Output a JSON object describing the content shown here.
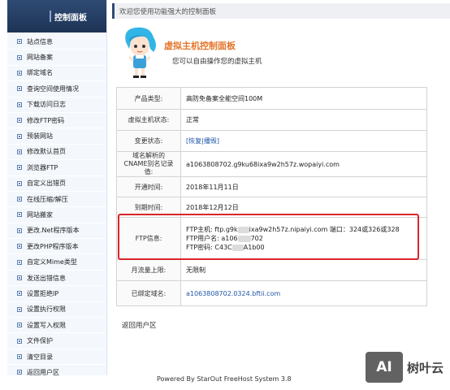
{
  "sidebar": {
    "title": "控制面板",
    "items": [
      {
        "label": "站点信息"
      },
      {
        "label": "网站备案"
      },
      {
        "label": "绑定域名"
      },
      {
        "label": "查询空间使用情况"
      },
      {
        "label": "下载访问日志"
      },
      {
        "label": "修改FTP密码"
      },
      {
        "label": "预装网站"
      },
      {
        "label": "修改默认首页"
      },
      {
        "label": "浏览器FTP"
      },
      {
        "label": "自定义出错页"
      },
      {
        "label": "在线压缩/解压"
      },
      {
        "label": "网站搬家"
      },
      {
        "label": "更改.Net程序版本"
      },
      {
        "label": "更改PHP程序版本"
      },
      {
        "label": "自定义Mime类型"
      },
      {
        "label": "发送出错信息"
      },
      {
        "label": "设置拒绝IP"
      },
      {
        "label": "设置执行权限"
      },
      {
        "label": "设置写入权限"
      },
      {
        "label": "文件保护"
      },
      {
        "label": "清空目录"
      },
      {
        "label": "返回用户区"
      }
    ]
  },
  "topbar": {
    "welcome": "欢迎您使用功能强大的控制面板"
  },
  "hero": {
    "title": "虚拟主机控制面板",
    "subtitle": "您可以自由操作您的虚拟主机"
  },
  "info": {
    "product_type_label": "产品类型:",
    "product_type_value": "高防免备案全能空间100M",
    "status_label": "虚拟主机状态:",
    "status_value": "正常",
    "change_label": "变更状态:",
    "change_value": "[恢复|播毁]",
    "cname_label": "域名解析的CNAME别名记录值:",
    "cname_value": "a1063808702.g9ku68ixa9w2h57z.wopaiyi.com",
    "open_label": "开通时间:",
    "open_value": "2018年11月11日",
    "expire_label": "到期时间:",
    "expire_value": "2018年12月12日",
    "ftp_label": "FTP信息:",
    "ftp_host_prefix": "FTP主机: ftp.g9k",
    "ftp_host_suffix": "ixa9w2h57z.nipaiyi.com 端口：324或326或328",
    "ftp_user_prefix": "FTP用户名: a106",
    "ftp_user_suffix": "702",
    "ftp_pass_prefix": "FTP密码: C43C",
    "ftp_pass_suffix": "A1b00",
    "traffic_label": "月流量上限:",
    "traffic_value": "无限制",
    "bound_label": "已绑定域名:",
    "bound_value": "a1063808702.0324.bftii.com"
  },
  "back_link": "返回用户区",
  "footer": "Powered By StarOut FreeHost System 3.8",
  "watermark": {
    "logo": "AI",
    "text": "树叶云"
  },
  "colors": {
    "sidebar_header": "#2f4b74",
    "accent": "#e4752b",
    "highlight": "#d9262b",
    "link": "#2255aa"
  }
}
